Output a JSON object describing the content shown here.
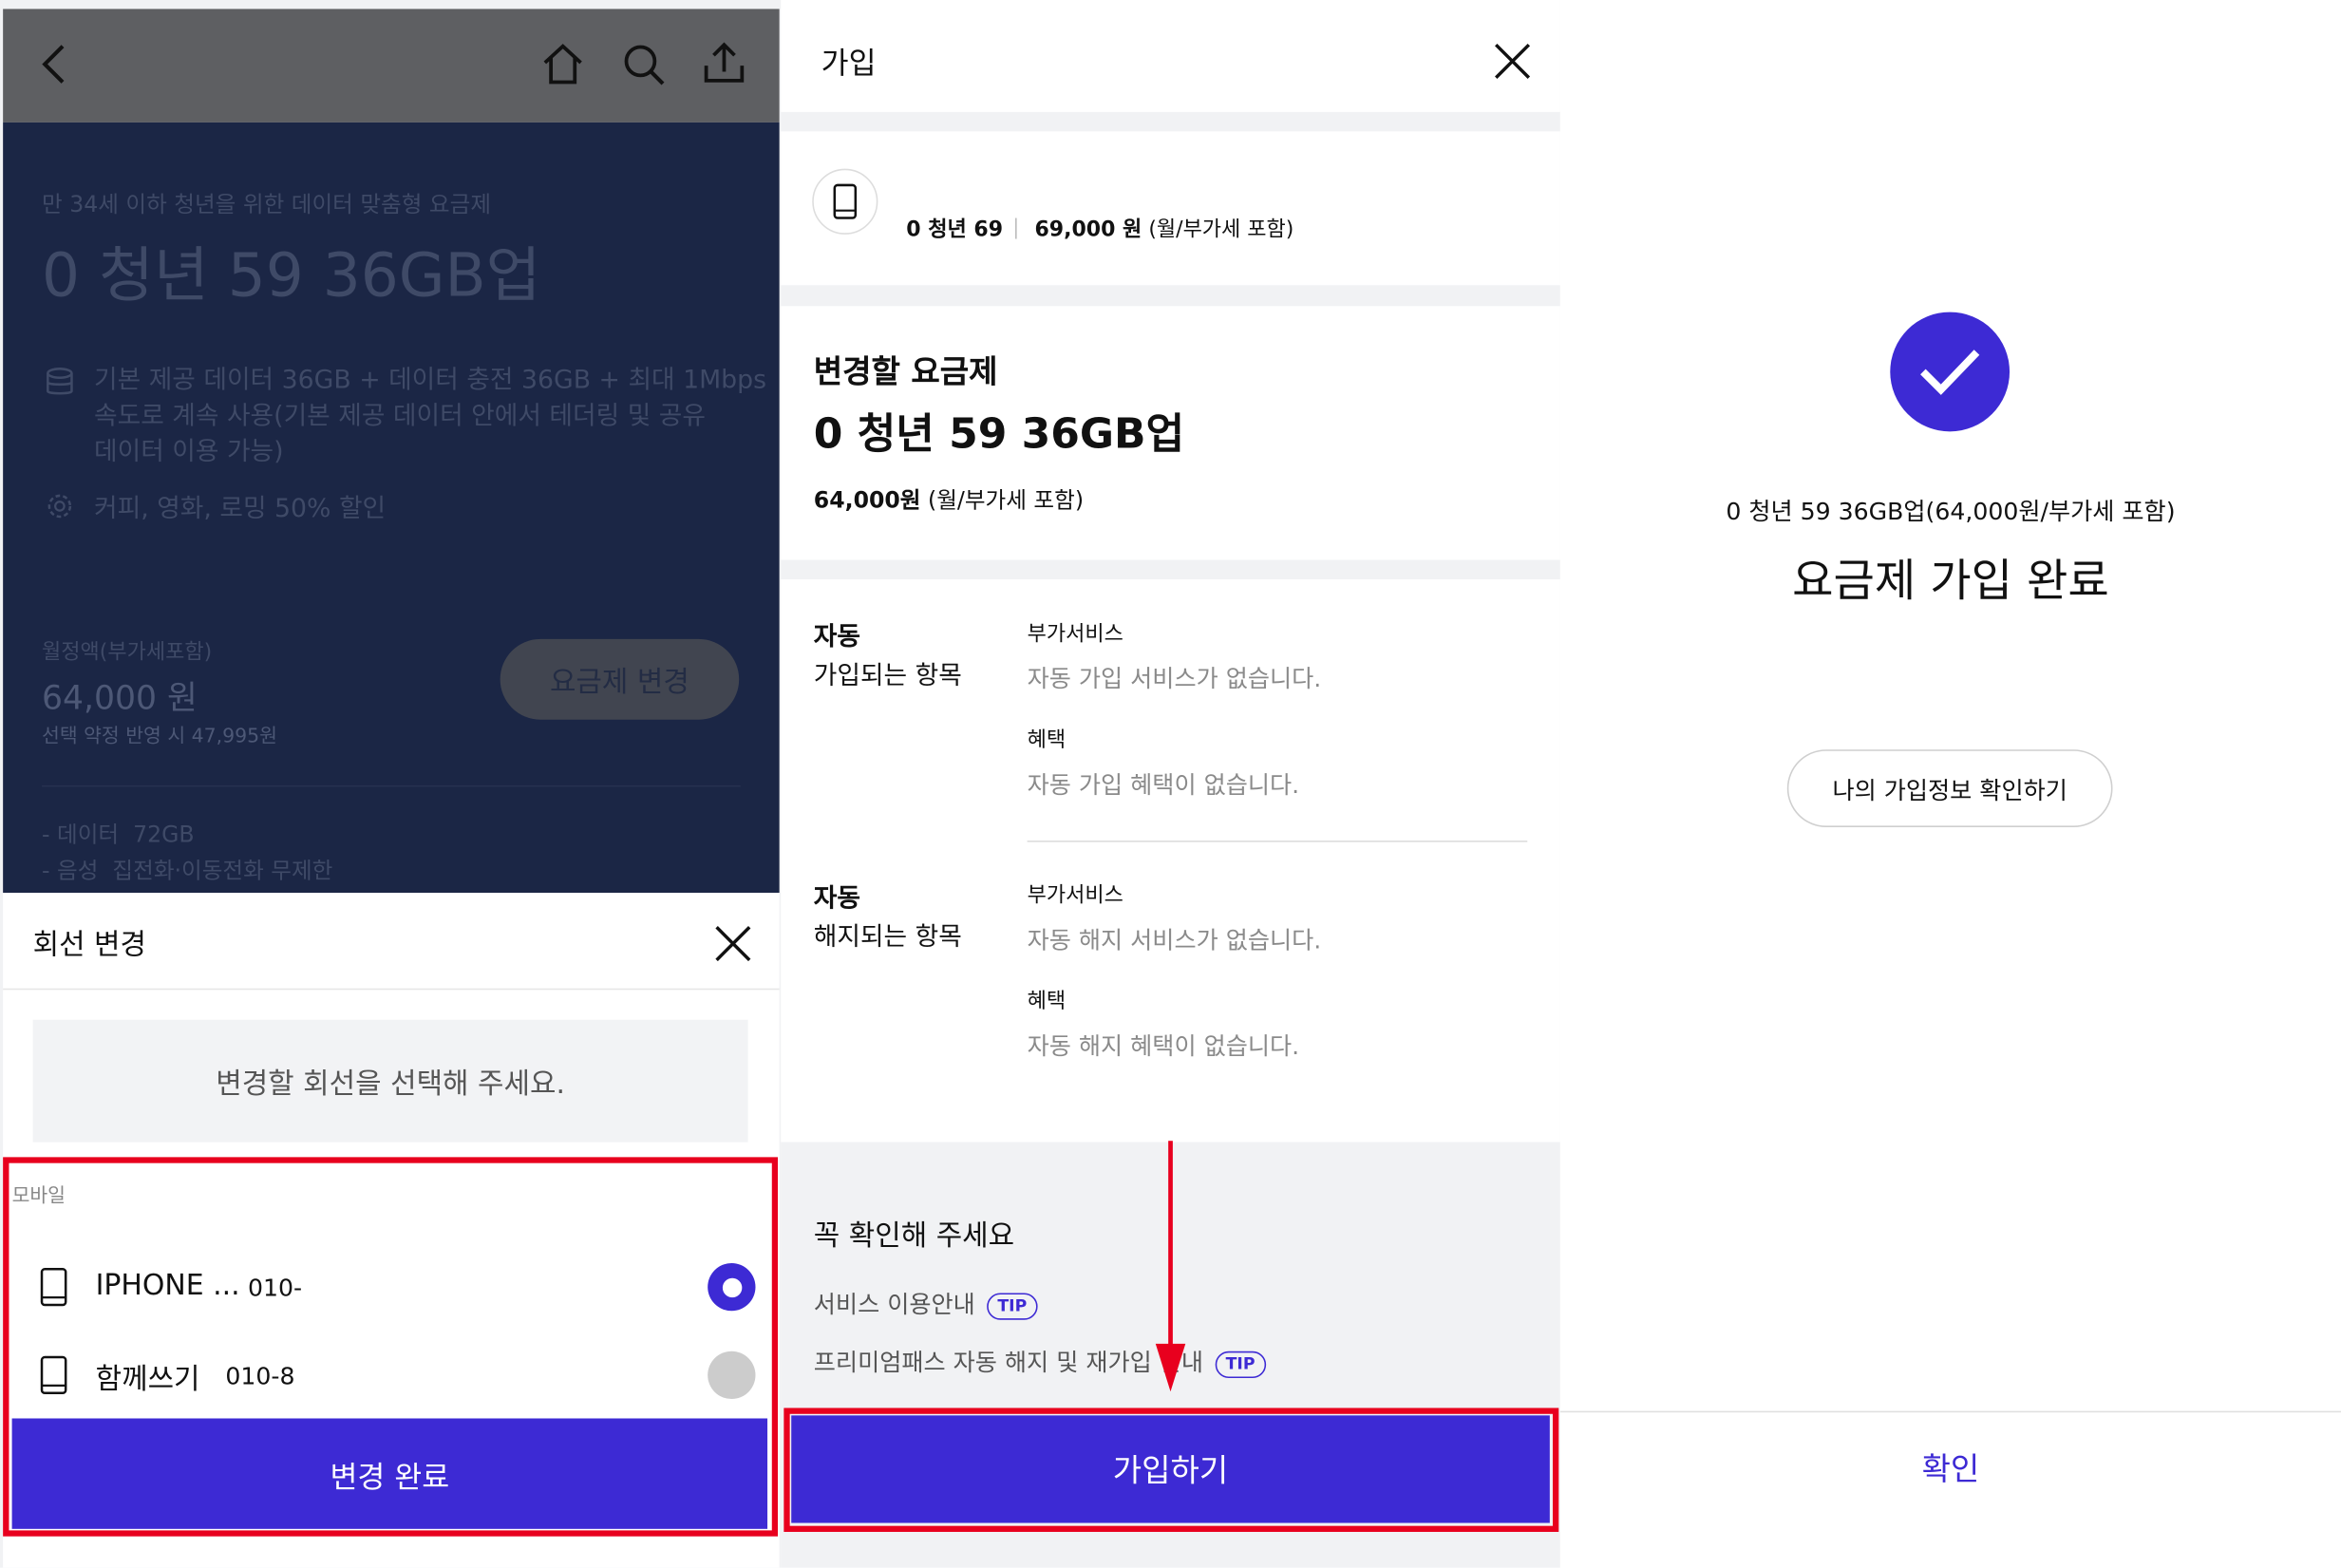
{
  "colors": {
    "accent": "#3d2ad4",
    "highlight": "#e8001e",
    "hero_bg": "#1b2645"
  },
  "panel1": {
    "topbar": {
      "back_icon": "chevron-left-icon",
      "home_icon": "home-icon",
      "search_icon": "search-icon",
      "share_icon": "share-icon"
    },
    "hero": {
      "subtitle": "만 34세 이하 청년을 위한 데이터 맞춤형 요금제",
      "title": "0 청년 59 36GB업",
      "feature1_line1": "기본 제공 데이터 36GB + 데이터 충전 36GB + 최대 1Mbps",
      "feature1_line2": "속도로 계속 사용(기본 제공 데이터 안에서 테더링 및 공유",
      "feature1_line3": "데이터 이용 가능)",
      "feature2": "커피, 영화, 로밍 50% 할인",
      "monthly_label": "월정액(부가세포함)",
      "monthly_price": "64,000 원",
      "discount_note": "선택 약정 반영 시 47,995원",
      "change_plan_button": "요금제 변경",
      "detail_data_label": "- 데이터",
      "detail_data_value": "72GB",
      "detail_voice_label": "- 음성",
      "detail_voice_value": "집전화·이동전화 무제한"
    },
    "sheet": {
      "title": "회선 변경",
      "message": "변경할 회선을 선택해 주세요.",
      "section_label": "모바일",
      "lines": [
        {
          "name": "IPHONE ...",
          "number": "010-",
          "selected": true
        },
        {
          "name": "함께쓰기",
          "number": "010-8",
          "selected": false
        }
      ],
      "confirm_button": "변경 완료"
    }
  },
  "panel2": {
    "header_title": "가입",
    "current_plan_name": "0 청년 69",
    "current_plan_price": "69,000 원",
    "current_plan_vat": "(월/부가세 포함)",
    "new_plan_label": "변경할 요금제",
    "new_plan_name": "0 청년 59 36GB업",
    "new_plan_price": "64,000원",
    "new_plan_vat": "(월/부가세 포함)",
    "auto_join": {
      "label_line1": "자동",
      "label_line2": "가입되는 항목",
      "addon_label": "부가서비스",
      "addon_value": "자동 가입 서비스가 없습니다.",
      "benefit_label": "혜택",
      "benefit_value": "자동 가입 혜택이 없습니다."
    },
    "auto_cancel": {
      "label_line1": "자동",
      "label_line2": "해지되는 항목",
      "addon_label": "부가서비스",
      "addon_value": "자동 해지 서비스가 없습니다.",
      "benefit_label": "혜택",
      "benefit_value": "자동 해지 혜택이 없습니다."
    },
    "notice_title": "꼭 확인해 주세요",
    "notice_items": [
      "서비스 이용안내",
      "프리미엄패스 자동 해지 및 재가입 안내"
    ],
    "tip_label": "TIP",
    "join_button": "가입하기"
  },
  "panel3": {
    "plan_summary": "0 청년 59 36GB업(64,000원/부가세 포함)",
    "complete_title": "요금제 가입 완료",
    "check_info_button": "나의 가입정보 확인하기",
    "confirm_button": "확인"
  }
}
